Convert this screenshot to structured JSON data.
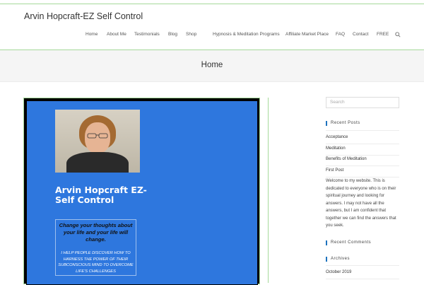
{
  "site": {
    "title": "Arvin Hopcraft-EZ Self Control"
  },
  "nav": {
    "items": [
      {
        "label": "Home",
        "key": "home"
      },
      {
        "label": "About Me",
        "key": "about-me"
      },
      {
        "label": "Testimonials",
        "key": "testimonials"
      },
      {
        "label": "Blog",
        "key": "blog"
      },
      {
        "label": "Shop",
        "key": "shop"
      },
      {
        "label": "Hypnosis & Meditation Programs",
        "key": "programs"
      },
      {
        "label": "Affiliate Market Place",
        "key": "affiliate"
      },
      {
        "label": "FAQ",
        "key": "faq"
      },
      {
        "label": "Contact",
        "key": "contact"
      },
      {
        "label": "FREE",
        "key": "free"
      }
    ],
    "search_icon": "search-icon"
  },
  "page": {
    "title": "Home"
  },
  "hero": {
    "title": "Arvin Hopcraft EZ-Self Control",
    "quote": "Change your thoughts about your life and your life will change.",
    "mission": "I HELP PEOPLE DISCOVER HOW TO HARNESS THE POWER OF THEIR SUBCONSCIOUS MIND TO OVERCOME LIFE'S CHALLENGES",
    "background": "#2e77de"
  },
  "sidebar": {
    "search_placeholder": "Search",
    "recent_posts": {
      "title": "Recent Posts",
      "items": [
        "Acceptance",
        "Meditation",
        "Benefits of Meditation",
        "First Post"
      ]
    },
    "about_text": "Welcome to my website. This is dedicated to everyone who is on their spiritual journey and looking for answers. I may not have all the answers, but I am confident that together we can find the answers that you seek.",
    "recent_comments": {
      "title": "Recent Comments"
    },
    "archives": {
      "title": "Archives",
      "items": [
        "October 2019"
      ]
    }
  },
  "colors": {
    "accent": "#a6d99a",
    "widget_marker": "#1e73be"
  }
}
